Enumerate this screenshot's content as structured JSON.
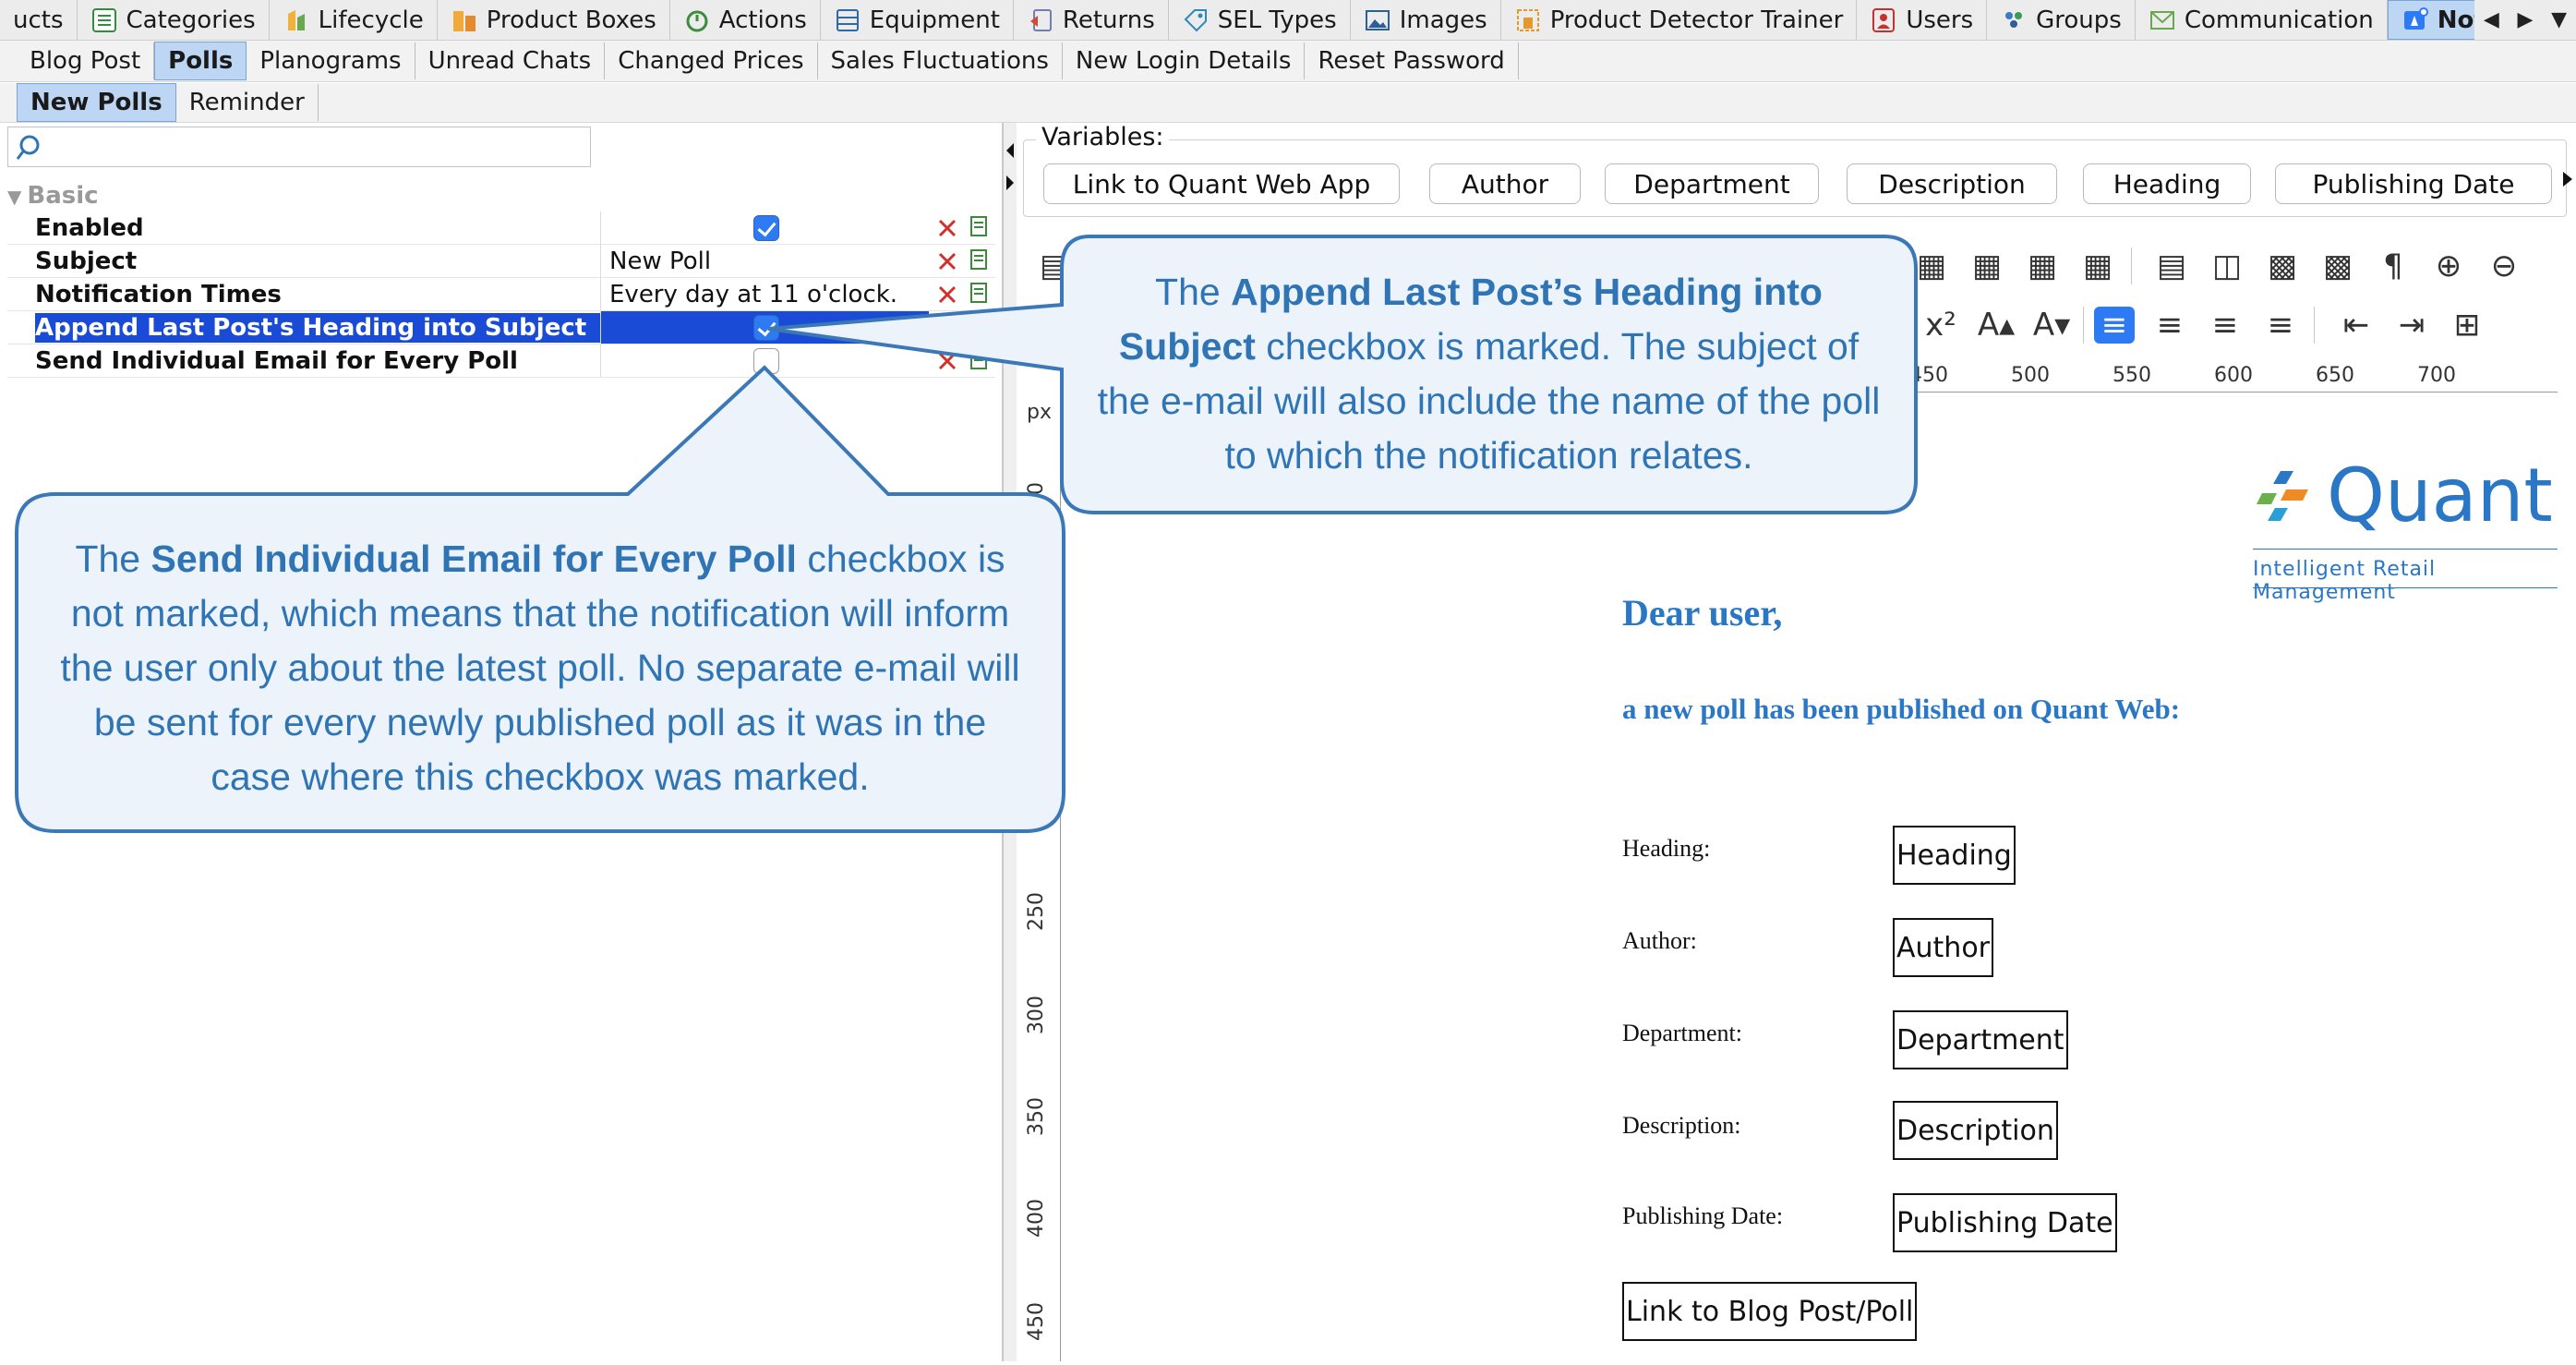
{
  "top_tabs": [
    {
      "label": "ucts",
      "icon": ""
    },
    {
      "label": "Categories",
      "icon": "list-icon"
    },
    {
      "label": "Lifecycle",
      "icon": "lifecycle-icon"
    },
    {
      "label": "Product Boxes",
      "icon": "boxes-icon"
    },
    {
      "label": "Actions",
      "icon": "actions-icon"
    },
    {
      "label": "Equipment",
      "icon": "equipment-icon"
    },
    {
      "label": "Returns",
      "icon": "returns-icon"
    },
    {
      "label": "SEL Types",
      "icon": "tag-icon"
    },
    {
      "label": "Images",
      "icon": "image-icon"
    },
    {
      "label": "Product Detector Trainer",
      "icon": "detector-icon"
    },
    {
      "label": "Users",
      "icon": "user-icon"
    },
    {
      "label": "Groups",
      "icon": "groups-icon"
    },
    {
      "label": "Communication",
      "icon": "envelope-icon"
    },
    {
      "label": "Notifications",
      "icon": "notification-icon",
      "active": true
    }
  ],
  "sub_tabs": [
    "Blog Post",
    "Polls",
    "Planograms",
    "Unread Chats",
    "Changed Prices",
    "Sales Fluctuations",
    "New Login Details",
    "Reset Password"
  ],
  "sub_tabs_active": "Polls",
  "sub_sub_tabs": [
    "New Polls",
    "Reminder"
  ],
  "sub_sub_tabs_active": "New Polls",
  "search": {
    "value": "",
    "placeholder": ""
  },
  "properties": {
    "group": "Basic",
    "rows": [
      {
        "label": "Enabled",
        "type": "checkbox",
        "checked": true
      },
      {
        "label": "Subject",
        "type": "text",
        "value": "New Poll"
      },
      {
        "label": "Notification Times",
        "type": "text",
        "value": "Every day at 11 o'clock."
      },
      {
        "label": "Append Last Post's Heading into Subject",
        "type": "checkbox",
        "checked": true,
        "selected": true
      },
      {
        "label": "Send Individual Email for Every Poll",
        "type": "checkbox",
        "checked": false
      }
    ]
  },
  "variables": {
    "legend": "Variables:",
    "buttons": [
      "Link to Quant Web App",
      "Author",
      "Department",
      "Description",
      "Heading",
      "Publishing Date"
    ]
  },
  "ruler": {
    "unit": "px",
    "h_labels": [
      "450",
      "500",
      "550",
      "600",
      "650",
      "700"
    ],
    "v_labels": [
      "250",
      "300",
      "350",
      "400",
      "450"
    ],
    "v_label_partial": "00"
  },
  "document": {
    "logo_word": "Quant",
    "logo_tagline": "Intelligent Retail Management",
    "greeting": "Dear user,",
    "intro": "a new poll has been published on Quant Web:",
    "fields": [
      {
        "label": "Heading:",
        "var": "Heading"
      },
      {
        "label": "Author:",
        "var": "Author"
      },
      {
        "label": "Department:",
        "var": "Department"
      },
      {
        "label": "Description:",
        "var": "Description"
      },
      {
        "label": "Publishing Date:",
        "var": "Publishing Date"
      }
    ],
    "link_var": "Link to Blog Post/Poll"
  },
  "callouts": {
    "top": {
      "pre": "The ",
      "bold": "Append Last Post’s Heading into Subject",
      "post": " checkbox is marked. The subject of the e-mail will also include the name of the poll to which the notification relates."
    },
    "bottom": {
      "pre": "The ",
      "bold": "Send Individual Email for Every Poll",
      "post": " checkbox is not marked, which means that the notification will inform the user only about the latest poll. No separate e-mail will be sent for every newly published poll as it was in the case where this checkbox was marked."
    }
  },
  "colors": {
    "accent": "#2e7af2",
    "selection": "#1a4bd6",
    "callout_text": "#2f74b5",
    "callout_border": "#3b78b8",
    "callout_fill": "#edf3fa",
    "brand": "#2a77c6"
  }
}
